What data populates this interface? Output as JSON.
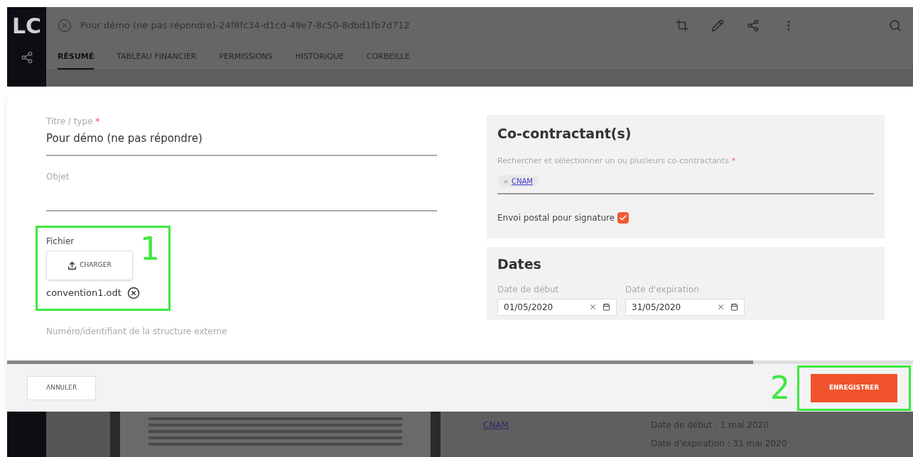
{
  "logo": "LC",
  "header": {
    "title": "Pour démo (ne pas répondre)-24f8fc34-d1cd-49e7-8c50-8dbd1fb7d712"
  },
  "tabs": [
    {
      "label": "RÉSUMÉ",
      "selected": true
    },
    {
      "label": "TABLEAU FINANCIER",
      "selected": false
    },
    {
      "label": "PERMISSIONS",
      "selected": false
    },
    {
      "label": "HISTORIQUE",
      "selected": false
    },
    {
      "label": "CORBEILLE",
      "selected": false
    }
  ],
  "modal": {
    "left_fields": [
      {
        "label": "Titre / type",
        "required_mark": "*",
        "value": "Pour démo (ne pas répondre)"
      },
      {
        "label": "Objet"
      }
    ],
    "file": {
      "label": "Fichier",
      "button": "CHARGER",
      "filename": "convention1.odt"
    },
    "external_id_label": "Numéro/identifiant de la structure externe",
    "cocontractants": {
      "title": "Co-contractant(s)",
      "search_label": "Rechercher et sélectionner un ou plusieurs co-contractants",
      "required_mark": "*",
      "chips": [
        {
          "label": "CNAM"
        }
      ],
      "postal": {
        "label": "Envoi postal pour signature",
        "checked": true
      }
    },
    "dates": {
      "title": "Dates",
      "fields": [
        {
          "label": "Date de début",
          "value": "01/05/2020"
        },
        {
          "label": "Date d'expiration",
          "value": "31/05/2020"
        }
      ]
    },
    "cancel_button": "ANNULER",
    "save_button": "ENREGISTRER"
  },
  "annotations": [
    {
      "label": "1"
    },
    {
      "label": "2"
    }
  ],
  "background": {
    "link": "CNAM",
    "details": [
      "Date de début : 1 mai 2020",
      "Date d'expiration : 31 mai 2020"
    ]
  }
}
